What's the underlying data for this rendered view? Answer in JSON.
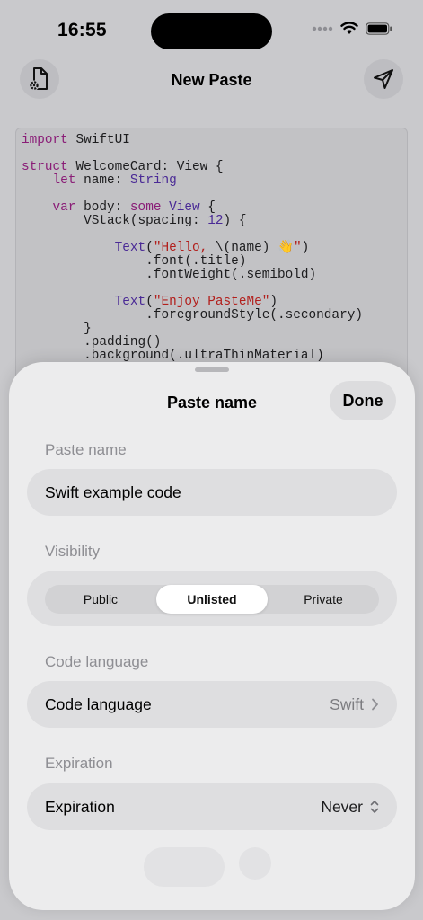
{
  "status": {
    "time": "16:55"
  },
  "nav": {
    "title": "New Paste",
    "left_icon": "file-settings-icon",
    "right_icon": "send-icon"
  },
  "code_lines": [
    [
      {
        "t": "import",
        "c": "kw"
      },
      {
        "t": " SwiftUI",
        "c": ""
      }
    ],
    [],
    [
      {
        "t": "struct",
        "c": "kw"
      },
      {
        "t": " WelcomeCard: View {",
        "c": ""
      }
    ],
    [
      {
        "t": "    ",
        "c": ""
      },
      {
        "t": "let",
        "c": "kw"
      },
      {
        "t": " name: ",
        "c": ""
      },
      {
        "t": "String",
        "c": "ty"
      }
    ],
    [],
    [
      {
        "t": "    ",
        "c": ""
      },
      {
        "t": "var",
        "c": "kw"
      },
      {
        "t": " body: ",
        "c": ""
      },
      {
        "t": "some",
        "c": "kw"
      },
      {
        "t": " ",
        "c": ""
      },
      {
        "t": "View",
        "c": "ty"
      },
      {
        "t": " {",
        "c": ""
      }
    ],
    [
      {
        "t": "        VStack(spacing: ",
        "c": ""
      },
      {
        "t": "12",
        "c": "ty"
      },
      {
        "t": ") {",
        "c": ""
      }
    ],
    [],
    [
      {
        "t": "            ",
        "c": ""
      },
      {
        "t": "Text",
        "c": "ty"
      },
      {
        "t": "(",
        "c": ""
      },
      {
        "t": "\"Hello, ",
        "c": "st"
      },
      {
        "t": "\\(name) 👋",
        "c": ""
      },
      {
        "t": "\"",
        "c": "st"
      },
      {
        "t": ")",
        "c": ""
      }
    ],
    [
      {
        "t": "                .font(.title)",
        "c": ""
      }
    ],
    [
      {
        "t": "                .fontWeight(.semibold)",
        "c": ""
      }
    ],
    [],
    [
      {
        "t": "            ",
        "c": ""
      },
      {
        "t": "Text",
        "c": "ty"
      },
      {
        "t": "(",
        "c": ""
      },
      {
        "t": "\"Enjoy PasteMe\"",
        "c": "st"
      },
      {
        "t": ")",
        "c": ""
      }
    ],
    [
      {
        "t": "                .foregroundStyle(.secondary)",
        "c": ""
      }
    ],
    [
      {
        "t": "        }",
        "c": ""
      }
    ],
    [
      {
        "t": "        .padding()",
        "c": ""
      }
    ],
    [
      {
        "t": "        .background(.ultraThinMaterial)",
        "c": ""
      }
    ]
  ],
  "sheet": {
    "title": "Paste name",
    "done_label": "Done",
    "name_section": "Paste name",
    "name_value": "Swift example code",
    "visibility_section": "Visibility",
    "visibility_options": [
      "Public",
      "Unlisted",
      "Private"
    ],
    "visibility_selected": "Unlisted",
    "language_section": "Code language",
    "language_label": "Code language",
    "language_value": "Swift",
    "expiration_section": "Expiration",
    "expiration_label": "Expiration",
    "expiration_value": "Never"
  }
}
